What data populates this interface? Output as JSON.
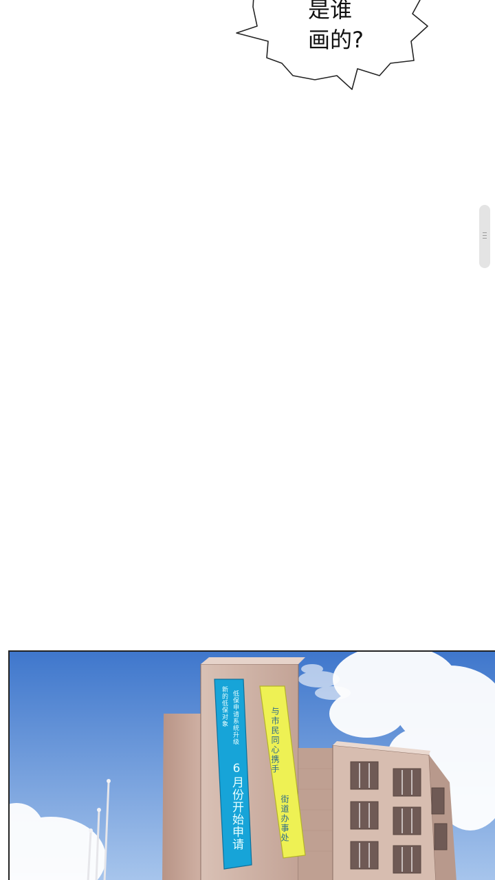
{
  "speech_bubble": {
    "line1": "是谁",
    "line2": "画的?"
  },
  "banners": {
    "blue": {
      "col1": "新的低保对象",
      "col2": "低保申请系统升级",
      "col3": "6月份开始申请"
    },
    "yellow": {
      "col1": "与市民同心携手",
      "col2": "街道办事处"
    }
  },
  "colors": {
    "sky_top": "#4f86d2",
    "sky_bottom": "#a9c7ec",
    "building": "#c9a99c",
    "blue_banner": "#1aa7d9",
    "yellow_banner": "#f1f25a"
  }
}
